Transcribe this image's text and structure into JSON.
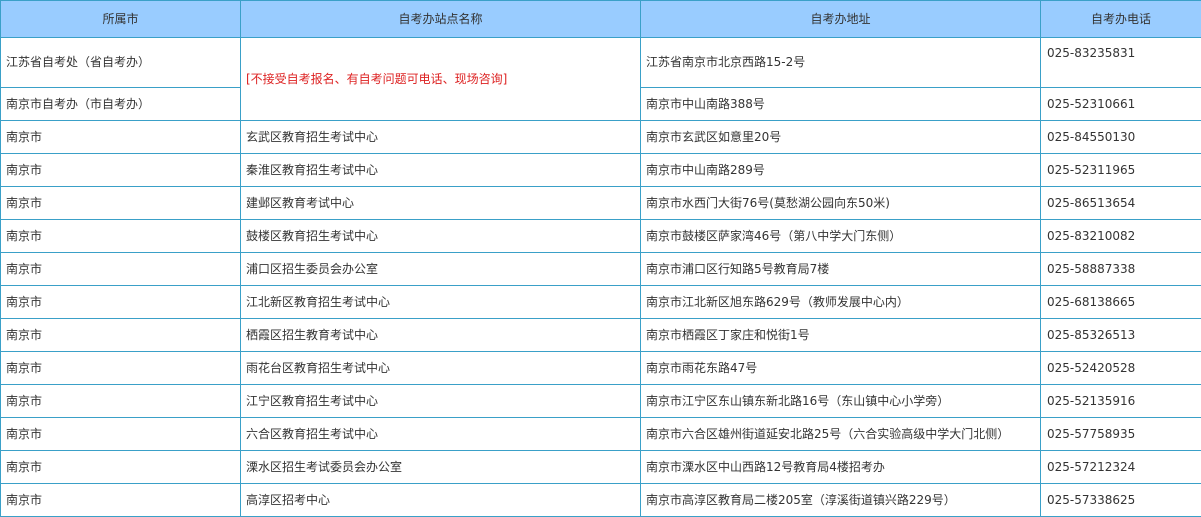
{
  "table": {
    "headers": [
      "所属市",
      "自考办站点名称",
      "自考办地址",
      "自考办电话"
    ],
    "merged_note": "[不接受自考报名、有自考问题可电话、现场咨询]",
    "rows": [
      {
        "city": "江苏省自考处（省自考办）",
        "address": "江苏省南京市北京西路15-2号",
        "phone": "025-83235831"
      },
      {
        "city": "南京市自考办（市自考办）",
        "address": "南京市中山南路388号",
        "phone": "025-52310661"
      },
      {
        "city": "南京市",
        "site": "玄武区教育招生考试中心",
        "address": "南京市玄武区如意里20号",
        "phone": "025-84550130"
      },
      {
        "city": "南京市",
        "site": "秦淮区教育招生考试中心",
        "address": "南京市中山南路289号",
        "phone": "025-52311965"
      },
      {
        "city": "南京市",
        "site": "建邺区教育考试中心",
        "address": "南京市水西门大街76号(莫愁湖公园向东50米)",
        "phone": "025-86513654"
      },
      {
        "city": "南京市",
        "site": "鼓楼区教育招生考试中心",
        "address": "南京市鼓楼区萨家湾46号（第八中学大门东侧）",
        "phone": "025-83210082"
      },
      {
        "city": "南京市",
        "site": "浦口区招生委员会办公室",
        "address": "南京市浦口区行知路5号教育局7楼",
        "phone": "025-58887338"
      },
      {
        "city": "南京市",
        "site": "江北新区教育招生考试中心",
        "address": "南京市江北新区旭东路629号（教师发展中心内）",
        "phone": "025-68138665"
      },
      {
        "city": "南京市",
        "site": "栖霞区招生教育考试中心",
        "address": "南京市栖霞区丁家庄和悦街1号",
        "phone": "025-85326513"
      },
      {
        "city": "南京市",
        "site": "雨花台区教育招生考试中心",
        "address": "南京市雨花东路47号",
        "phone": "025-52420528"
      },
      {
        "city": "南京市",
        "site": "江宁区教育招生考试中心",
        "address": "南京市江宁区东山镇东新北路16号（东山镇中心小学旁）",
        "phone": "025-52135916"
      },
      {
        "city": "南京市",
        "site": "六合区教育招生考试中心",
        "address": "南京市六合区雄州街道延安北路25号（六合实验高级中学大门北侧）",
        "phone": "025-57758935"
      },
      {
        "city": "南京市",
        "site": "溧水区招生考试委员会办公室",
        "address": "南京市溧水区中山西路12号教育局4楼招考办",
        "phone": "025-57212324"
      },
      {
        "city": "南京市",
        "site": "高淳区招考中心",
        "address": "南京市高淳区教育局二楼205室（淳溪街道镇兴路229号）",
        "phone": "025-57338625"
      }
    ]
  }
}
